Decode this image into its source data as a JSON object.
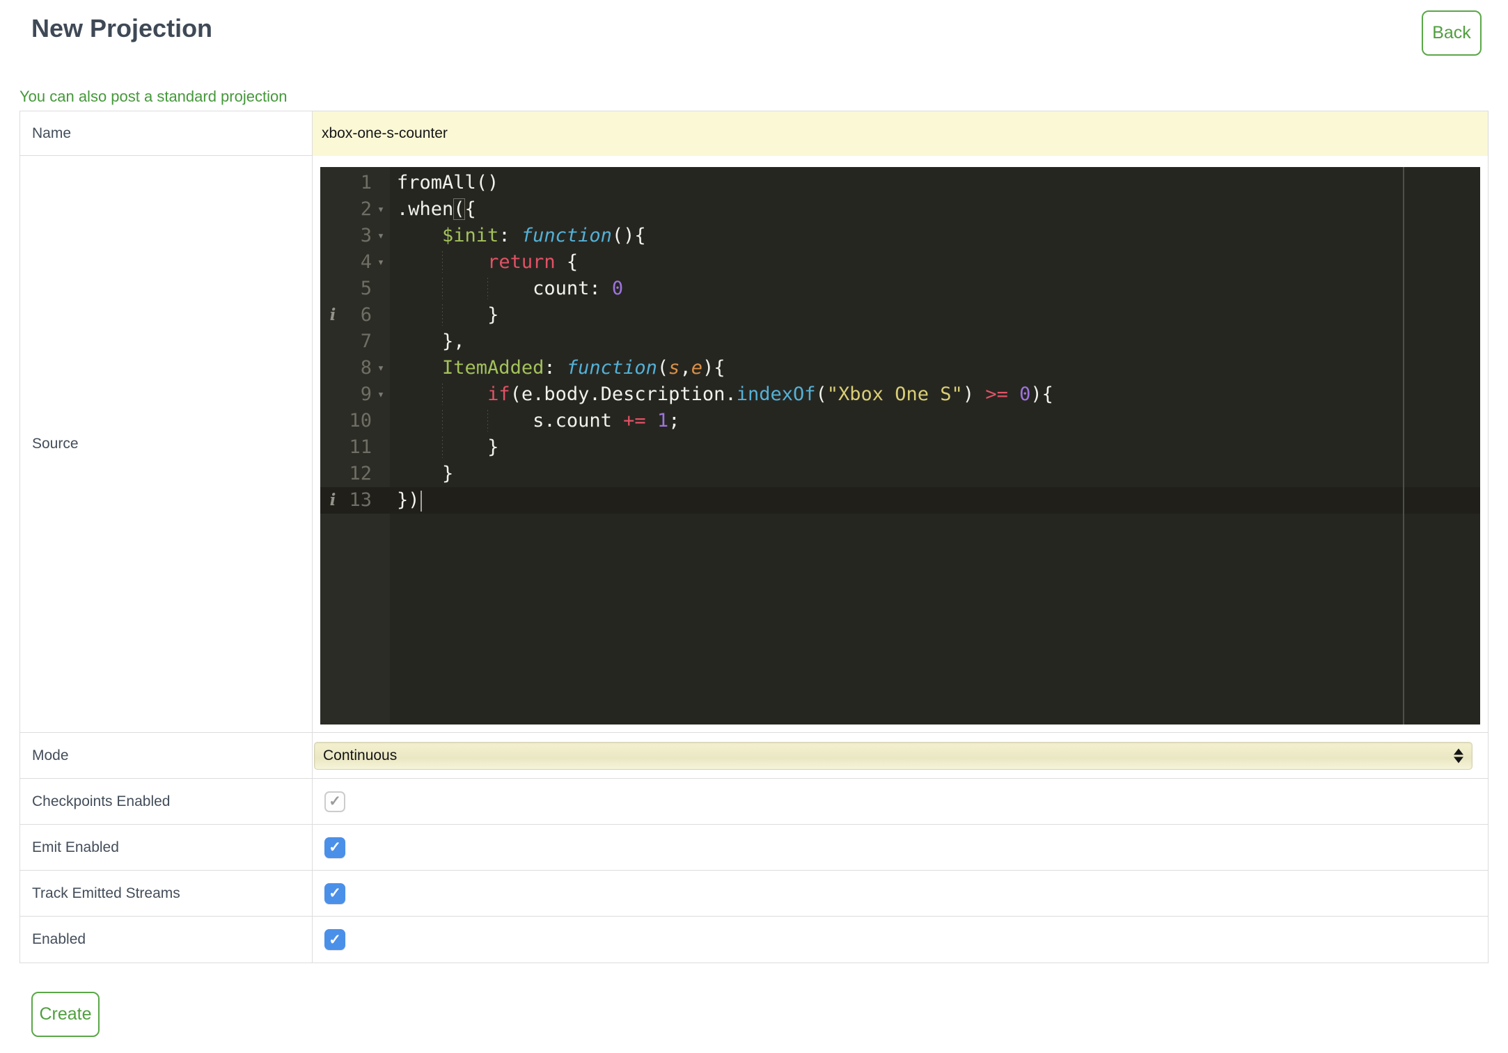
{
  "colors": {
    "accent_green": "#5aa747",
    "link_green": "#45983a",
    "heading_text": "#3f4956",
    "field_highlight_yellow": "#fbf8d6",
    "checkbox_blue": "#4a90e9",
    "editor_background": "#262621",
    "editor_gutter": "#2c2c26",
    "syntax": {
      "plain": "#f2f2ec",
      "property": "#a3c25a",
      "keyword": "#e25265",
      "function_keyword": "#54b1d6",
      "method": "#54b1d6",
      "argument": "#db9046",
      "number": "#9d74dd",
      "string": "#d9ce74"
    }
  },
  "header": {
    "title": "New Projection",
    "back_label": "Back"
  },
  "link": {
    "text": "You can also post a standard projection"
  },
  "form": {
    "name_row": {
      "label": "Name",
      "value": "xbox-one-s-counter"
    },
    "source_row": {
      "label": "Source"
    },
    "mode_row": {
      "label": "Mode",
      "value": "Continuous"
    },
    "checkbox_rows": [
      {
        "label": "Checkpoints Enabled",
        "checked": true,
        "disabled": true
      },
      {
        "label": "Emit Enabled",
        "checked": true,
        "disabled": false
      },
      {
        "label": "Track Emitted Streams",
        "checked": true,
        "disabled": false
      },
      {
        "label": "Enabled",
        "checked": true,
        "disabled": false
      }
    ],
    "create_label": "Create"
  },
  "editor": {
    "active_line": 13,
    "lines": [
      {
        "n": 1,
        "marker": "",
        "fold": false,
        "seg": [
          [
            "p",
            "fromAll()"
          ]
        ]
      },
      {
        "n": 2,
        "marker": "",
        "fold": true,
        "seg": [
          [
            "p",
            ".when"
          ],
          [
            "mb",
            "("
          ],
          [
            "p",
            "{"
          ]
        ]
      },
      {
        "n": 3,
        "marker": "",
        "fold": true,
        "seg": [
          [
            "sp",
            "    "
          ],
          [
            "prop",
            "$init"
          ],
          [
            "p",
            ": "
          ],
          [
            "fn",
            "function"
          ],
          [
            "p",
            "(){"
          ]
        ]
      },
      {
        "n": 4,
        "marker": "",
        "fold": true,
        "seg": [
          [
            "sp",
            "    "
          ],
          [
            "g",
            "    "
          ],
          [
            "kw",
            "return"
          ],
          [
            "p",
            " {"
          ]
        ]
      },
      {
        "n": 5,
        "marker": "",
        "fold": false,
        "seg": [
          [
            "sp",
            "    "
          ],
          [
            "g",
            "    "
          ],
          [
            "g",
            "    "
          ],
          [
            "p",
            "count: "
          ],
          [
            "num",
            "0"
          ]
        ]
      },
      {
        "n": 6,
        "marker": "i",
        "fold": false,
        "seg": [
          [
            "sp",
            "    "
          ],
          [
            "g",
            "    "
          ],
          [
            "p",
            "}"
          ]
        ]
      },
      {
        "n": 7,
        "marker": "",
        "fold": false,
        "seg": [
          [
            "sp",
            "    "
          ],
          [
            "p",
            "},"
          ]
        ]
      },
      {
        "n": 8,
        "marker": "",
        "fold": true,
        "seg": [
          [
            "sp",
            "    "
          ],
          [
            "prop",
            "ItemAdded"
          ],
          [
            "p",
            ": "
          ],
          [
            "fn",
            "function"
          ],
          [
            "p",
            "("
          ],
          [
            "arg",
            "s"
          ],
          [
            "p",
            ","
          ],
          [
            "arg",
            "e"
          ],
          [
            "p",
            "){"
          ]
        ]
      },
      {
        "n": 9,
        "marker": "",
        "fold": true,
        "seg": [
          [
            "sp",
            "    "
          ],
          [
            "g",
            "    "
          ],
          [
            "kw",
            "if"
          ],
          [
            "p",
            "(e.body.Description."
          ],
          [
            "call",
            "indexOf"
          ],
          [
            "p",
            "("
          ],
          [
            "str",
            "\"Xbox One S\""
          ],
          [
            "p",
            ") "
          ],
          [
            "kw",
            ">="
          ],
          [
            "p",
            " "
          ],
          [
            "num",
            "0"
          ],
          [
            "p",
            "){"
          ]
        ]
      },
      {
        "n": 10,
        "marker": "",
        "fold": false,
        "seg": [
          [
            "sp",
            "    "
          ],
          [
            "g",
            "    "
          ],
          [
            "g",
            "    "
          ],
          [
            "p",
            "s.count "
          ],
          [
            "kw",
            "+="
          ],
          [
            "p",
            " "
          ],
          [
            "num",
            "1"
          ],
          [
            "p",
            ";"
          ]
        ]
      },
      {
        "n": 11,
        "marker": "",
        "fold": false,
        "seg": [
          [
            "sp",
            "    "
          ],
          [
            "g",
            "    "
          ],
          [
            "p",
            "}"
          ]
        ]
      },
      {
        "n": 12,
        "marker": "",
        "fold": false,
        "seg": [
          [
            "sp",
            "    "
          ],
          [
            "p",
            "}"
          ]
        ]
      },
      {
        "n": 13,
        "marker": "i",
        "fold": false,
        "seg": [
          [
            "p",
            "})"
          ],
          [
            "cur",
            ""
          ]
        ]
      }
    ]
  }
}
